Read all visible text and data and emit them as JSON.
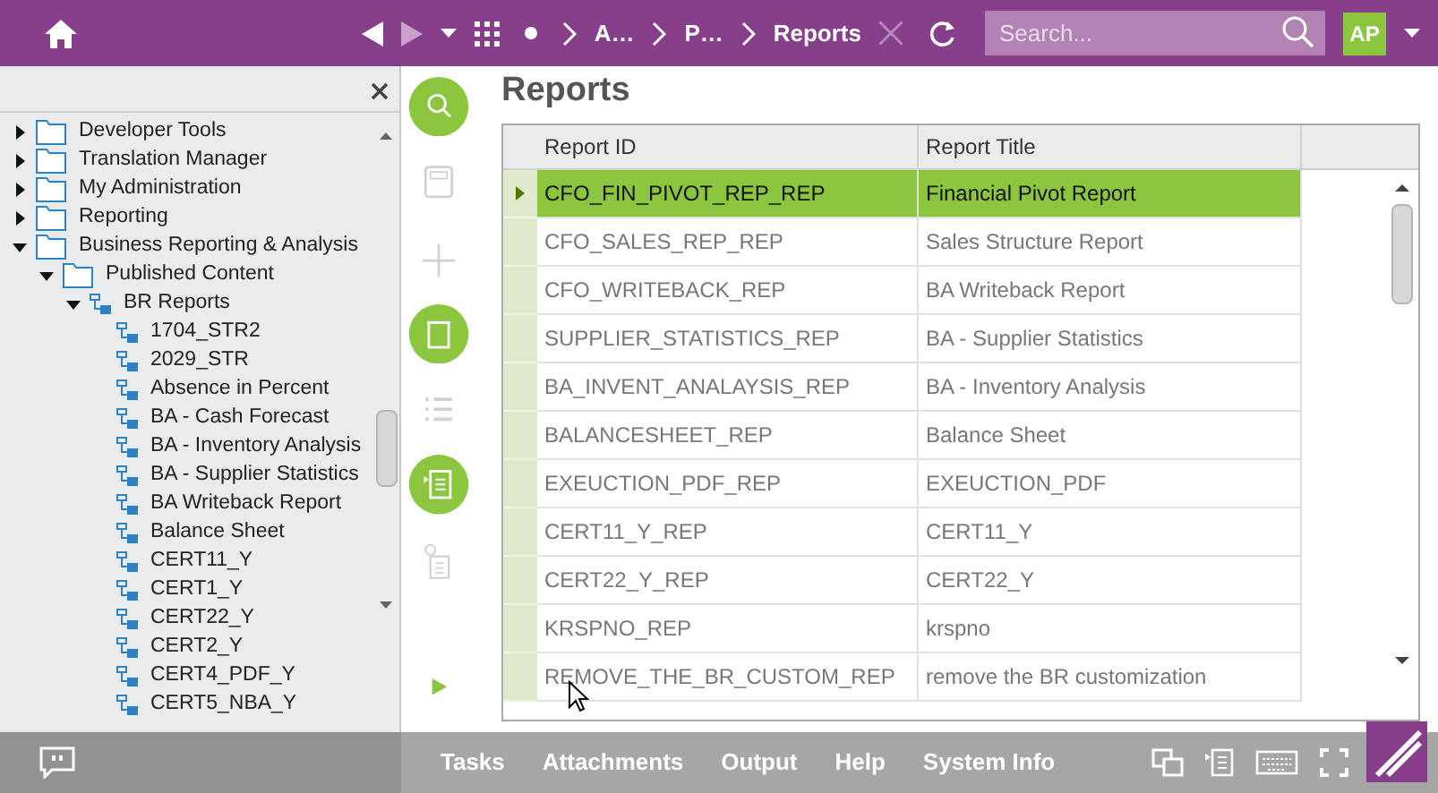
{
  "top_bar": {
    "breadcrumbs": [
      "A…",
      "P…",
      "Reports"
    ],
    "search": {
      "placeholder": "Search..."
    },
    "user": "AP"
  },
  "navigator": {
    "tree": [
      {
        "label": "Developer Tools",
        "expanded": false,
        "kind": "folder"
      },
      {
        "label": "Translation Manager",
        "expanded": false,
        "kind": "folder"
      },
      {
        "label": "My Administration",
        "expanded": false,
        "kind": "folder"
      },
      {
        "label": "Reporting",
        "expanded": false,
        "kind": "folder"
      },
      {
        "label": "Business Reporting & Analysis",
        "expanded": true,
        "kind": "folder",
        "children": [
          {
            "label": "Published Content",
            "expanded": true,
            "kind": "folder",
            "children": [
              {
                "label": "BR Reports",
                "expanded": true,
                "kind": "structure",
                "children": [
                  {
                    "label": "1704_STR2",
                    "kind": "structure"
                  },
                  {
                    "label": "2029_STR",
                    "kind": "structure"
                  },
                  {
                    "label": "Absence in Percent",
                    "kind": "structure"
                  },
                  {
                    "label": "BA - Cash Forecast",
                    "kind": "structure"
                  },
                  {
                    "label": "BA - Inventory Analysis",
                    "kind": "structure"
                  },
                  {
                    "label": "BA - Supplier Statistics",
                    "kind": "structure"
                  },
                  {
                    "label": "BA Writeback Report",
                    "kind": "structure"
                  },
                  {
                    "label": "Balance Sheet",
                    "kind": "structure"
                  },
                  {
                    "label": "CERT11_Y",
                    "kind": "structure"
                  },
                  {
                    "label": "CERT1_Y",
                    "kind": "structure"
                  },
                  {
                    "label": "CERT22_Y",
                    "kind": "structure"
                  },
                  {
                    "label": "CERT2_Y",
                    "kind": "structure"
                  },
                  {
                    "label": "CERT4_PDF_Y",
                    "kind": "structure"
                  },
                  {
                    "label": "CERT5_NBA_Y",
                    "kind": "structure"
                  }
                ]
              }
            ]
          }
        ]
      }
    ]
  },
  "toolbar": [
    {
      "kind": "search",
      "enabled": true
    },
    {
      "kind": "save",
      "enabled": false
    },
    {
      "kind": "add",
      "enabled": false
    },
    {
      "kind": "delete",
      "enabled": true
    },
    {
      "kind": "list",
      "enabled": false
    },
    {
      "kind": "details",
      "enabled": true
    },
    {
      "kind": "info",
      "enabled": false
    },
    {
      "kind": "play",
      "enabled": true
    }
  ],
  "page_title": "Reports",
  "table": {
    "columns": [
      "Report ID",
      "Report Title"
    ],
    "rows": [
      {
        "cells": [
          "CFO_FIN_PIVOT_REP_REP",
          "Financial Pivot Report"
        ],
        "selected": true
      },
      {
        "cells": [
          "CFO_SALES_REP_REP",
          "Sales Structure Report"
        ],
        "selected": false
      },
      {
        "cells": [
          "CFO_WRITEBACK_REP",
          "BA Writeback Report"
        ],
        "selected": false
      },
      {
        "cells": [
          "SUPPLIER_STATISTICS_REP",
          "BA - Supplier Statistics"
        ],
        "selected": false
      },
      {
        "cells": [
          "BA_INVENT_ANALAYSIS_REP",
          "BA - Inventory Analysis"
        ],
        "selected": false
      },
      {
        "cells": [
          "BALANCESHEET_REP",
          "Balance Sheet"
        ],
        "selected": false
      },
      {
        "cells": [
          "EXEUCTION_PDF_REP",
          "EXEUCTION_PDF"
        ],
        "selected": false
      },
      {
        "cells": [
          "CERT11_Y_REP",
          "CERT11_Y"
        ],
        "selected": false
      },
      {
        "cells": [
          "CERT22_Y_REP",
          "CERT22_Y"
        ],
        "selected": false
      },
      {
        "cells": [
          "KRSPNO_REP",
          "krspno"
        ],
        "selected": false
      },
      {
        "cells": [
          "REMOVE_THE_BR_CUSTOM_REP",
          "remove the BR customization"
        ],
        "selected": false
      }
    ]
  },
  "footer": {
    "links": [
      "Tasks",
      "Attachments",
      "Output",
      "Help",
      "System Info"
    ]
  }
}
